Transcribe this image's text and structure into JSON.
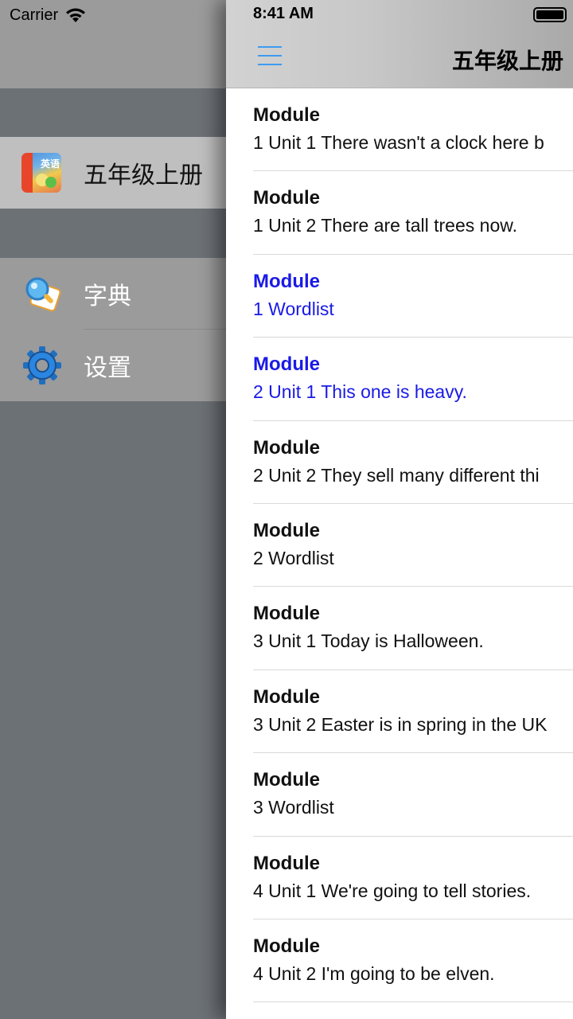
{
  "status_bar": {
    "carrier": "Carrier",
    "time": "8:41 AM"
  },
  "side_menu": {
    "items": [
      {
        "label": "五年级上册",
        "icon": "english-book-cover-icon",
        "selected": true
      },
      {
        "label": "字典",
        "icon": "dictionary-search-icon",
        "selected": false
      },
      {
        "label": "设置",
        "icon": "gear-icon",
        "selected": false
      }
    ]
  },
  "nav_bar": {
    "title": "五年级上册",
    "menu_icon": "hamburger-menu-icon",
    "accent_color": "#3d9bf0"
  },
  "lessons": {
    "highlight_color": "#1a1ae6",
    "items": [
      {
        "line1": "Module",
        "line2": "1  Unit 1 There wasn't a clock here b",
        "highlighted": false
      },
      {
        "line1": "Module",
        "line2": "1  Unit 2 There are tall trees now.",
        "highlighted": false
      },
      {
        "line1": "Module",
        "line2": "1  Wordlist",
        "highlighted": true
      },
      {
        "line1": "Module",
        "line2": "2  Unit 1 This one is heavy.",
        "highlighted": true
      },
      {
        "line1": "Module",
        "line2": "2  Unit 2 They sell many different thi",
        "highlighted": false
      },
      {
        "line1": "Module",
        "line2": "2  Wordlist",
        "highlighted": false
      },
      {
        "line1": "Module",
        "line2": "3  Unit 1 Today is Halloween.",
        "highlighted": false
      },
      {
        "line1": "Module",
        "line2": "3  Unit 2 Easter is in spring in the UK",
        "highlighted": false
      },
      {
        "line1": "Module",
        "line2": "3  Wordlist",
        "highlighted": false
      },
      {
        "line1": "Module",
        "line2": "4  Unit 1 We're going to tell stories.",
        "highlighted": false
      },
      {
        "line1": "Module",
        "line2": "4  Unit 2 I'm going to be elven.",
        "highlighted": false
      }
    ]
  }
}
